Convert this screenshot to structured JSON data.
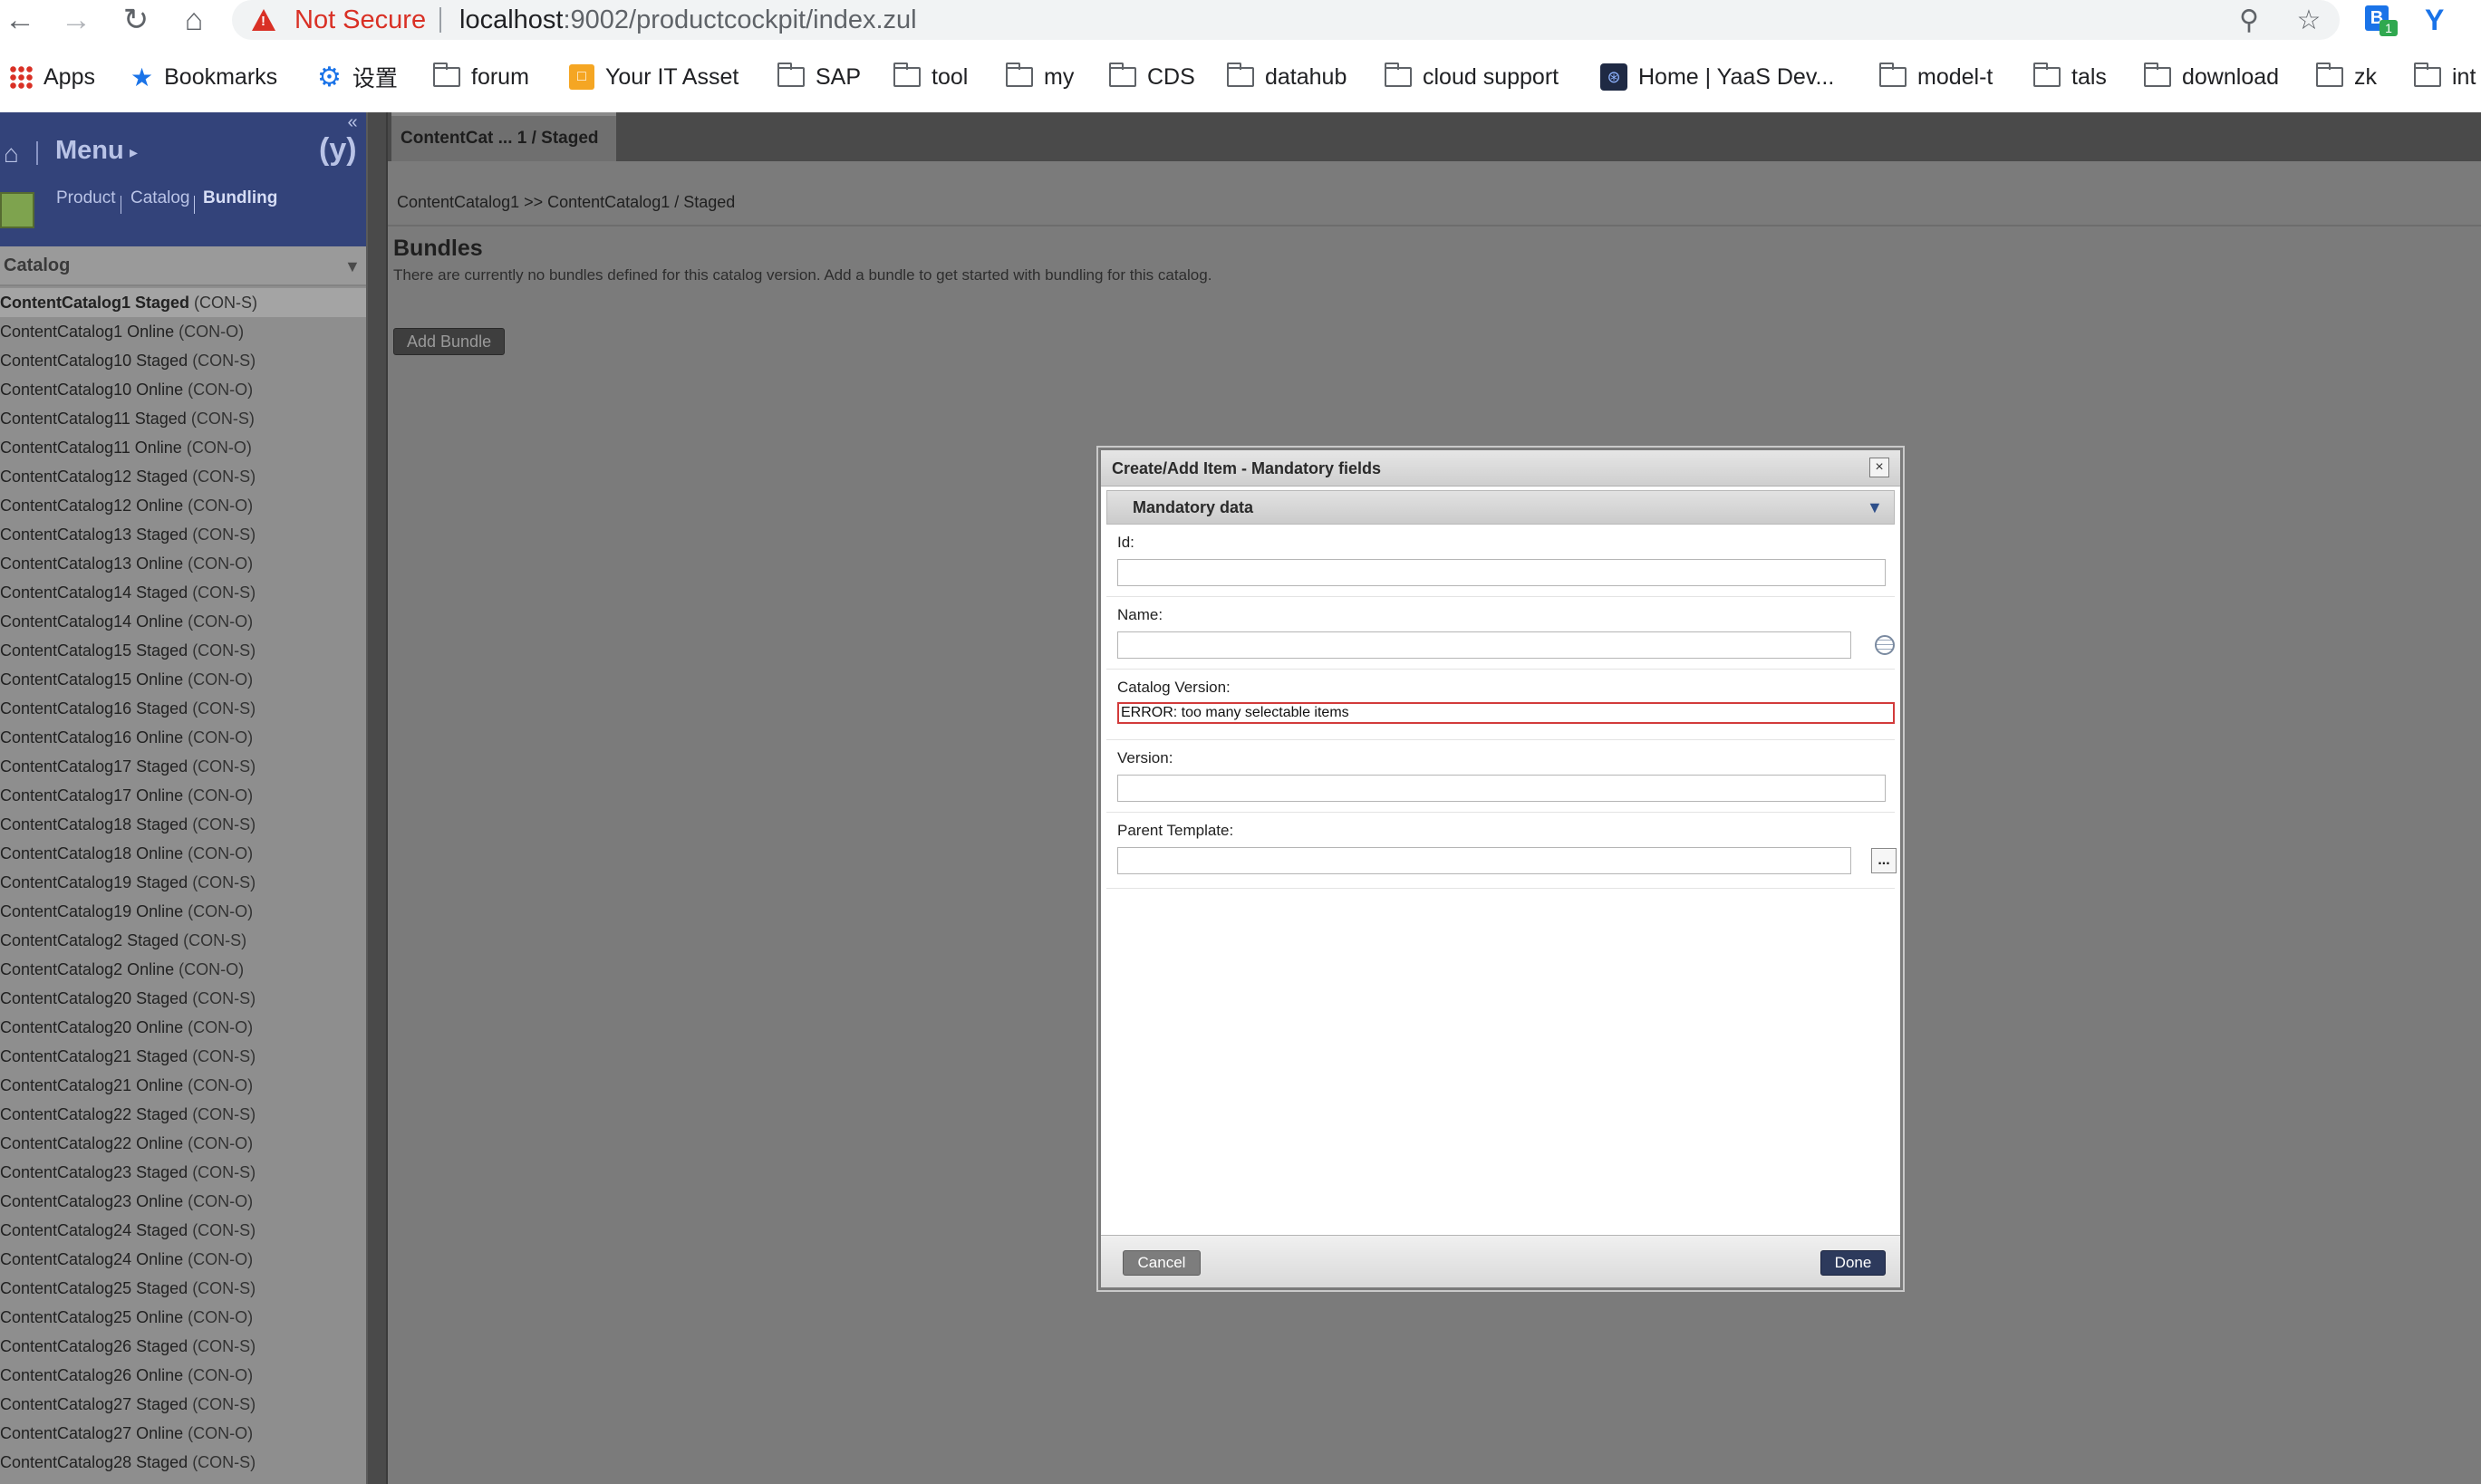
{
  "browser": {
    "security_label": "Not Secure",
    "url_host": "localhost",
    "url_rest": ":9002/productcockpit/index.zul",
    "ext_badge_letter": "B",
    "ext_badge_count": "1",
    "ext_y": "Y",
    "bookmarks": [
      "Apps",
      "Bookmarks",
      "设置",
      "forum",
      "Your IT Asset",
      "SAP",
      "tool",
      "my",
      "CDS",
      "datahub",
      "cloud support",
      "Home | YaaS Dev...",
      "model-t",
      "tals",
      "download",
      "zk",
      "int"
    ]
  },
  "sidebar": {
    "menu_label": "Menu",
    "perspectives": [
      "Product",
      "Catalog",
      "Bundling"
    ],
    "catalog_header": "Catalog",
    "catalog_items": [
      {
        "name": "ContentCatalog1 Staged",
        "code": "(CON-S)",
        "selected": true
      },
      {
        "name": "ContentCatalog1 Online",
        "code": "(CON-O)"
      },
      {
        "name": "ContentCatalog10 Staged",
        "code": "(CON-S)"
      },
      {
        "name": "ContentCatalog10 Online",
        "code": "(CON-O)"
      },
      {
        "name": "ContentCatalog11 Staged",
        "code": "(CON-S)"
      },
      {
        "name": "ContentCatalog11 Online",
        "code": "(CON-O)"
      },
      {
        "name": "ContentCatalog12 Staged",
        "code": "(CON-S)"
      },
      {
        "name": "ContentCatalog12 Online",
        "code": "(CON-O)"
      },
      {
        "name": "ContentCatalog13 Staged",
        "code": "(CON-S)"
      },
      {
        "name": "ContentCatalog13 Online",
        "code": "(CON-O)"
      },
      {
        "name": "ContentCatalog14 Staged",
        "code": "(CON-S)"
      },
      {
        "name": "ContentCatalog14 Online",
        "code": "(CON-O)"
      },
      {
        "name": "ContentCatalog15 Staged",
        "code": "(CON-S)"
      },
      {
        "name": "ContentCatalog15 Online",
        "code": "(CON-O)"
      },
      {
        "name": "ContentCatalog16 Staged",
        "code": "(CON-S)"
      },
      {
        "name": "ContentCatalog16 Online",
        "code": "(CON-O)"
      },
      {
        "name": "ContentCatalog17 Staged",
        "code": "(CON-S)"
      },
      {
        "name": "ContentCatalog17 Online",
        "code": "(CON-O)"
      },
      {
        "name": "ContentCatalog18 Staged",
        "code": "(CON-S)"
      },
      {
        "name": "ContentCatalog18 Online",
        "code": "(CON-O)"
      },
      {
        "name": "ContentCatalog19 Staged",
        "code": "(CON-S)"
      },
      {
        "name": "ContentCatalog19 Online",
        "code": "(CON-O)"
      },
      {
        "name": "ContentCatalog2 Staged",
        "code": "(CON-S)"
      },
      {
        "name": "ContentCatalog2 Online",
        "code": "(CON-O)"
      },
      {
        "name": "ContentCatalog20 Staged",
        "code": "(CON-S)"
      },
      {
        "name": "ContentCatalog20 Online",
        "code": "(CON-O)"
      },
      {
        "name": "ContentCatalog21 Staged",
        "code": "(CON-S)"
      },
      {
        "name": "ContentCatalog21 Online",
        "code": "(CON-O)"
      },
      {
        "name": "ContentCatalog22 Staged",
        "code": "(CON-S)"
      },
      {
        "name": "ContentCatalog22 Online",
        "code": "(CON-O)"
      },
      {
        "name": "ContentCatalog23 Staged",
        "code": "(CON-S)"
      },
      {
        "name": "ContentCatalog23 Online",
        "code": "(CON-O)"
      },
      {
        "name": "ContentCatalog24 Staged",
        "code": "(CON-S)"
      },
      {
        "name": "ContentCatalog24 Online",
        "code": "(CON-O)"
      },
      {
        "name": "ContentCatalog25 Staged",
        "code": "(CON-S)"
      },
      {
        "name": "ContentCatalog25 Online",
        "code": "(CON-O)"
      },
      {
        "name": "ContentCatalog26 Staged",
        "code": "(CON-S)"
      },
      {
        "name": "ContentCatalog26 Online",
        "code": "(CON-O)"
      },
      {
        "name": "ContentCatalog27 Staged",
        "code": "(CON-S)"
      },
      {
        "name": "ContentCatalog27 Online",
        "code": "(CON-O)"
      },
      {
        "name": "ContentCatalog28 Staged",
        "code": "(CON-S)"
      }
    ]
  },
  "main": {
    "tab_label": "ContentCat ... 1 / Staged",
    "breadcrumb": "ContentCatalog1 >> ContentCatalog1 / Staged",
    "title": "Bundles",
    "description": "There are currently no bundles defined for this catalog version. Add a bundle to get started with bundling for this catalog.",
    "add_button": "Add Bundle"
  },
  "dialog": {
    "title": "Create/Add Item - Mandatory fields",
    "section_title": "Mandatory data",
    "fields": {
      "id_label": "Id:",
      "id_value": "",
      "name_label": "Name:",
      "name_value": "",
      "catalog_version_label": "Catalog Version:",
      "catalog_version_value": "ERROR: too many selectable items",
      "version_label": "Version:",
      "version_value": "",
      "parent_template_label": "Parent Template:",
      "parent_template_value": ""
    },
    "browse_label": "...",
    "cancel_label": "Cancel",
    "done_label": "Done"
  },
  "colors": {
    "sidebar_header": "#33437a",
    "error_border": "#d23b3b",
    "done_button": "#2d3a5c"
  }
}
